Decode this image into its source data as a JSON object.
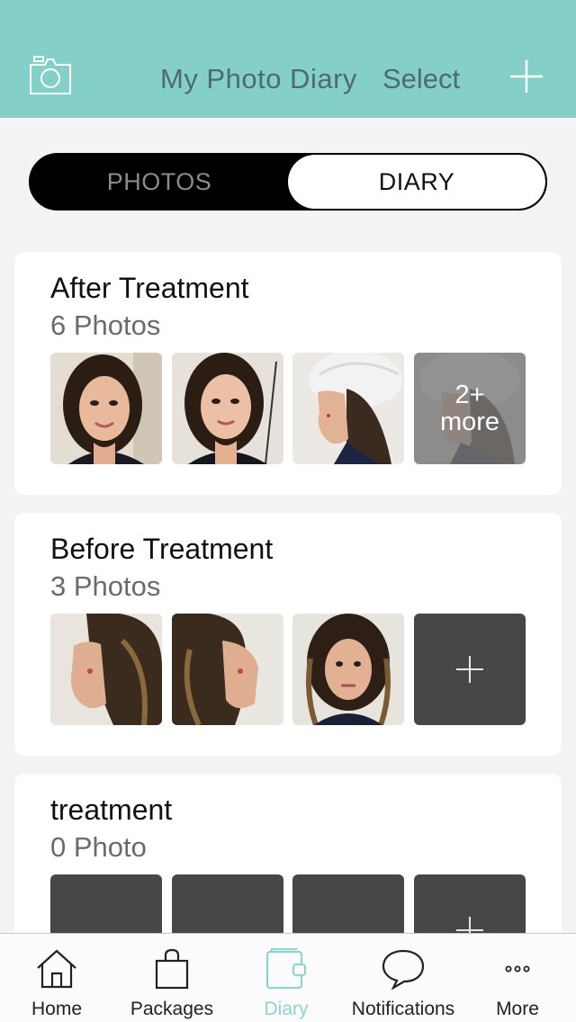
{
  "header": {
    "title": "My Photo Diary",
    "select_label": "Select"
  },
  "segment": {
    "photos_label": "PHOTOS",
    "diary_label": "DIARY",
    "active": "DIARY"
  },
  "albums": [
    {
      "name": "After Treatment",
      "count_label": "6 Photos",
      "thumbs": [
        "photo",
        "photo",
        "photo",
        "more"
      ],
      "more_line1": "2+",
      "more_line2": "more"
    },
    {
      "name": "Before Treatment",
      "count_label": "3 Photos",
      "thumbs": [
        "photo",
        "photo",
        "photo",
        "add"
      ]
    },
    {
      "name": "treatment",
      "count_label": "0 Photo",
      "thumbs": [
        "empty",
        "empty",
        "empty",
        "add"
      ]
    }
  ],
  "tabbar": {
    "items": [
      {
        "label": "Home",
        "icon": "home-icon"
      },
      {
        "label": "Packages",
        "icon": "shopping-bag-icon"
      },
      {
        "label": "Diary",
        "icon": "diary-icon",
        "active": true
      },
      {
        "label": "Notifications",
        "icon": "chat-bubble-icon"
      },
      {
        "label": "More",
        "icon": "ellipsis-icon"
      }
    ]
  },
  "colors": {
    "header_bg": "#85cfc9",
    "accent": "#8fd3cf",
    "placeholder": "#474747"
  }
}
